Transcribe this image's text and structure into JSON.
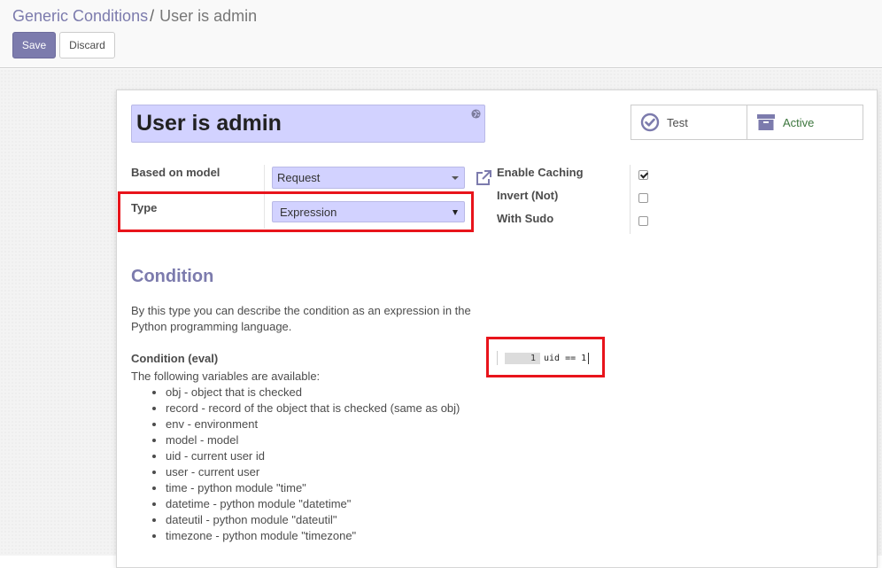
{
  "breadcrumb": {
    "parent": "Generic Conditions",
    "separator": "/",
    "current": "User is admin"
  },
  "toolbar": {
    "save_label": "Save",
    "discard_label": "Discard"
  },
  "record": {
    "name": "User is admin"
  },
  "button_box": {
    "test_label": "Test",
    "active_label": "Active"
  },
  "fields": {
    "based_on_model": {
      "label": "Based on model",
      "value": "Request"
    },
    "type": {
      "label": "Type",
      "value": "Expression"
    },
    "enable_caching": {
      "label": "Enable Caching",
      "checked": true
    },
    "invert_not": {
      "label": "Invert (Not)",
      "checked": false
    },
    "with_sudo": {
      "label": "With Sudo",
      "checked": false
    }
  },
  "condition": {
    "title": "Condition",
    "description": "By this type you can describe the condition as an expression in the Python programming language.",
    "eval_label": "Condition (eval)",
    "vars_intro": "The following variables are available:",
    "variables": [
      "obj - object that is checked",
      "record - record of the object that is checked (same as obj)",
      "env - environment",
      "model - model",
      "uid - current user id",
      "user - current user",
      "time - python module \"time\"",
      "datetime - python module \"datetime\"",
      "dateutil - python module \"dateutil\"",
      "timezone - python module \"timezone\""
    ],
    "code": {
      "line_number": "1",
      "text": "uid == 1"
    }
  },
  "colors": {
    "brand": "#7c7bad",
    "required_field_bg": "#d2d2ff",
    "highlight_red": "#e8141b",
    "active_green": "#3c763d"
  }
}
